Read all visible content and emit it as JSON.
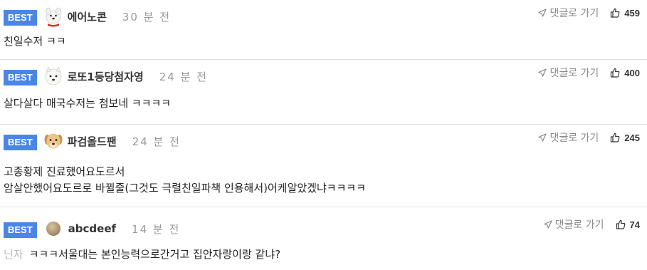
{
  "badge_label": "BEST",
  "reply_label": "댓글로 가기",
  "colors": {
    "badge_bg": "#4a86e8",
    "divider": "#dedede",
    "time_text": "#999999",
    "reply_text": "#888888"
  },
  "comments": [
    {
      "avatar_icon": "white-dog-red-collar-icon",
      "nickname": "에어노콘",
      "time": "30 분 전",
      "likes": "459",
      "lines": [
        "친일수저 ㅋㅋ"
      ]
    },
    {
      "avatar_icon": "white-dog-face-icon",
      "nickname": "로또1등당첨자영",
      "time": "24 분 전",
      "likes": "400",
      "lines": [
        "살다살다 매국수저는 첨보네 ㅋㅋㅋㅋ"
      ]
    },
    {
      "avatar_icon": "golden-puppy-icon",
      "nickname": "파검올드팬",
      "time": "24 분 전",
      "likes": "245",
      "lines": [
        "고종황제 진료했어요도르서",
        "암살안했어요도르로 바뀔줄(그것도 극렬친일파책 인용해서)어케알았겠냐ㅋㅋㅋㅋ"
      ]
    },
    {
      "avatar_icon": "brown-circle-avatar-icon",
      "nickname": "abcdeef",
      "time": "14 분 전",
      "likes": "74",
      "prefix": "닌자",
      "lines": [
        "ㅋㅋㅋ서울대는 본인능력으로간거고 집안자랑이랑 같냐?"
      ]
    }
  ]
}
